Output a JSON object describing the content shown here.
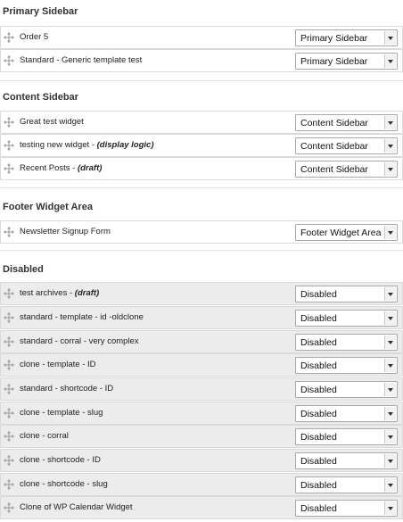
{
  "sections": [
    {
      "title": "Primary Sidebar",
      "rows": [
        {
          "label": "Order 5",
          "note": "",
          "select": "Primary Sidebar"
        },
        {
          "label": "Standard - Generic template test",
          "note": "",
          "select": "Primary Sidebar"
        }
      ]
    },
    {
      "title": "Content Sidebar",
      "rows": [
        {
          "label": "Great test widget",
          "note": "",
          "select": "Content Sidebar"
        },
        {
          "label": "testing new widget - ",
          "note": "(display logic)",
          "select": "Content Sidebar"
        },
        {
          "label": "Recent Posts - ",
          "note": "(draft)",
          "select": "Content Sidebar"
        }
      ]
    },
    {
      "title": "Footer Widget Area",
      "rows": [
        {
          "label": "Newsletter Signup Form",
          "note": "",
          "select": "Footer Widget Area"
        }
      ]
    },
    {
      "title": "Disabled",
      "rows": [
        {
          "label": "test archives - ",
          "note": "(draft)",
          "select": "Disabled"
        },
        {
          "label": "standard - template - id -oldclone",
          "note": "",
          "select": "Disabled"
        },
        {
          "label": "standard - corral - very complex",
          "note": "",
          "select": "Disabled"
        },
        {
          "label": "clone - template - ID",
          "note": "",
          "select": "Disabled"
        },
        {
          "label": "standard - shortcode - ID",
          "note": "",
          "select": "Disabled"
        },
        {
          "label": "clone - template - slug",
          "note": "",
          "select": "Disabled"
        },
        {
          "label": "clone - corral",
          "note": "",
          "select": "Disabled"
        },
        {
          "label": "clone - shortcode - ID",
          "note": "",
          "select": "Disabled"
        },
        {
          "label": "clone - shortcode - slug",
          "note": "",
          "select": "Disabled"
        },
        {
          "label": "Clone of WP Calendar Widget",
          "note": "",
          "select": "Disabled"
        }
      ]
    }
  ]
}
